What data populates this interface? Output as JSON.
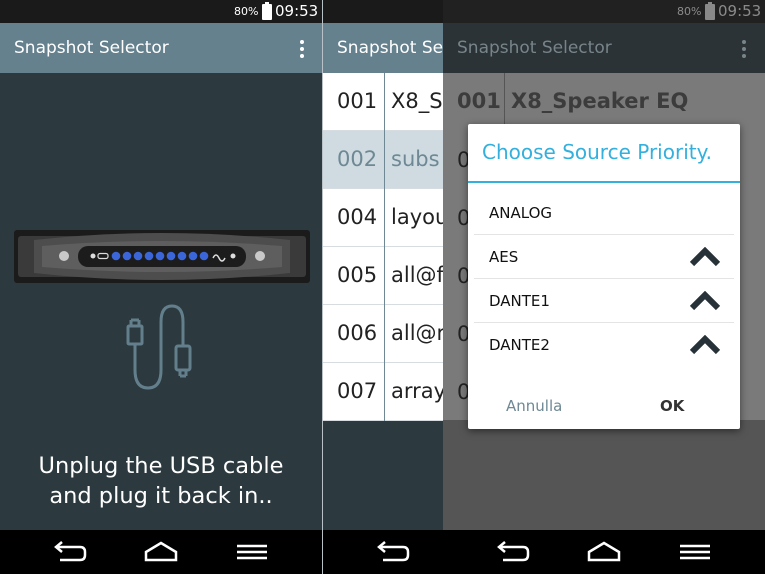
{
  "status": {
    "battery": "80%",
    "time": "09:53"
  },
  "left": {
    "title": "Snapshot Selector",
    "message_line1": "Unplug the USB cable",
    "message_line2": "and plug it back in.."
  },
  "right": {
    "title_under": "Snapshot Sel",
    "title_over": "Snapshot Selector",
    "header_row": {
      "num": "001",
      "name": "X8_Speaker EQ"
    },
    "rows": [
      {
        "num": "001",
        "name": "X8_S"
      },
      {
        "num": "002",
        "name": "subs"
      },
      {
        "num": "004",
        "name": "layou"
      },
      {
        "num": "005",
        "name": "all@f"
      },
      {
        "num": "006",
        "name": "all@r"
      },
      {
        "num": "007",
        "name": "array"
      }
    ],
    "dim_digit": "0",
    "dialog": {
      "title": "Choose Source Priority.",
      "items": [
        "ANALOG",
        "AES",
        "DANTE1",
        "DANTE2"
      ],
      "cancel": "Annulla",
      "ok": "OK"
    }
  },
  "colors": {
    "accent": "#33b0dd",
    "appbar": "#65818e",
    "background": "#2c3a40"
  }
}
